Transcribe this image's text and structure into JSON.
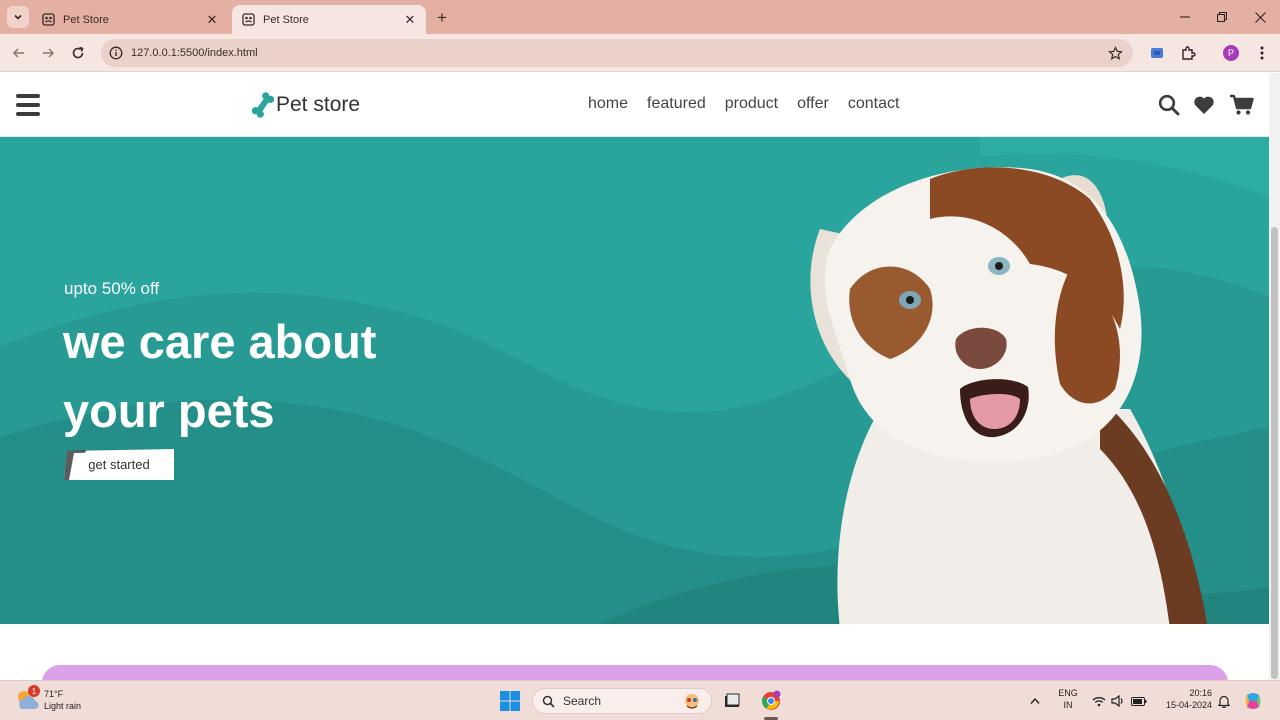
{
  "browser": {
    "tabs": [
      {
        "title": "Pet Store",
        "active": false
      },
      {
        "title": "Pet Store",
        "active": true
      }
    ],
    "url": "127.0.0.1:5500/index.html",
    "profile_initial": "P"
  },
  "site": {
    "logo_text": "Pet store",
    "nav": [
      "home",
      "featured",
      "product",
      "offer",
      "contact"
    ],
    "hero": {
      "subtitle": "upto 50% off",
      "title": "we care about your pets",
      "button": "get started"
    },
    "colors": {
      "hero_bg": "#2aa59d",
      "accent": "#2aa59d",
      "promo_strip": "#dba0e8"
    }
  },
  "taskbar": {
    "weather_temp": "71°F",
    "weather_desc": "Light rain",
    "weather_badge": "1",
    "search_label": "Search",
    "lang_line1": "ENG",
    "lang_line2": "IN",
    "time": "20:16",
    "date": "15-04-2024"
  }
}
